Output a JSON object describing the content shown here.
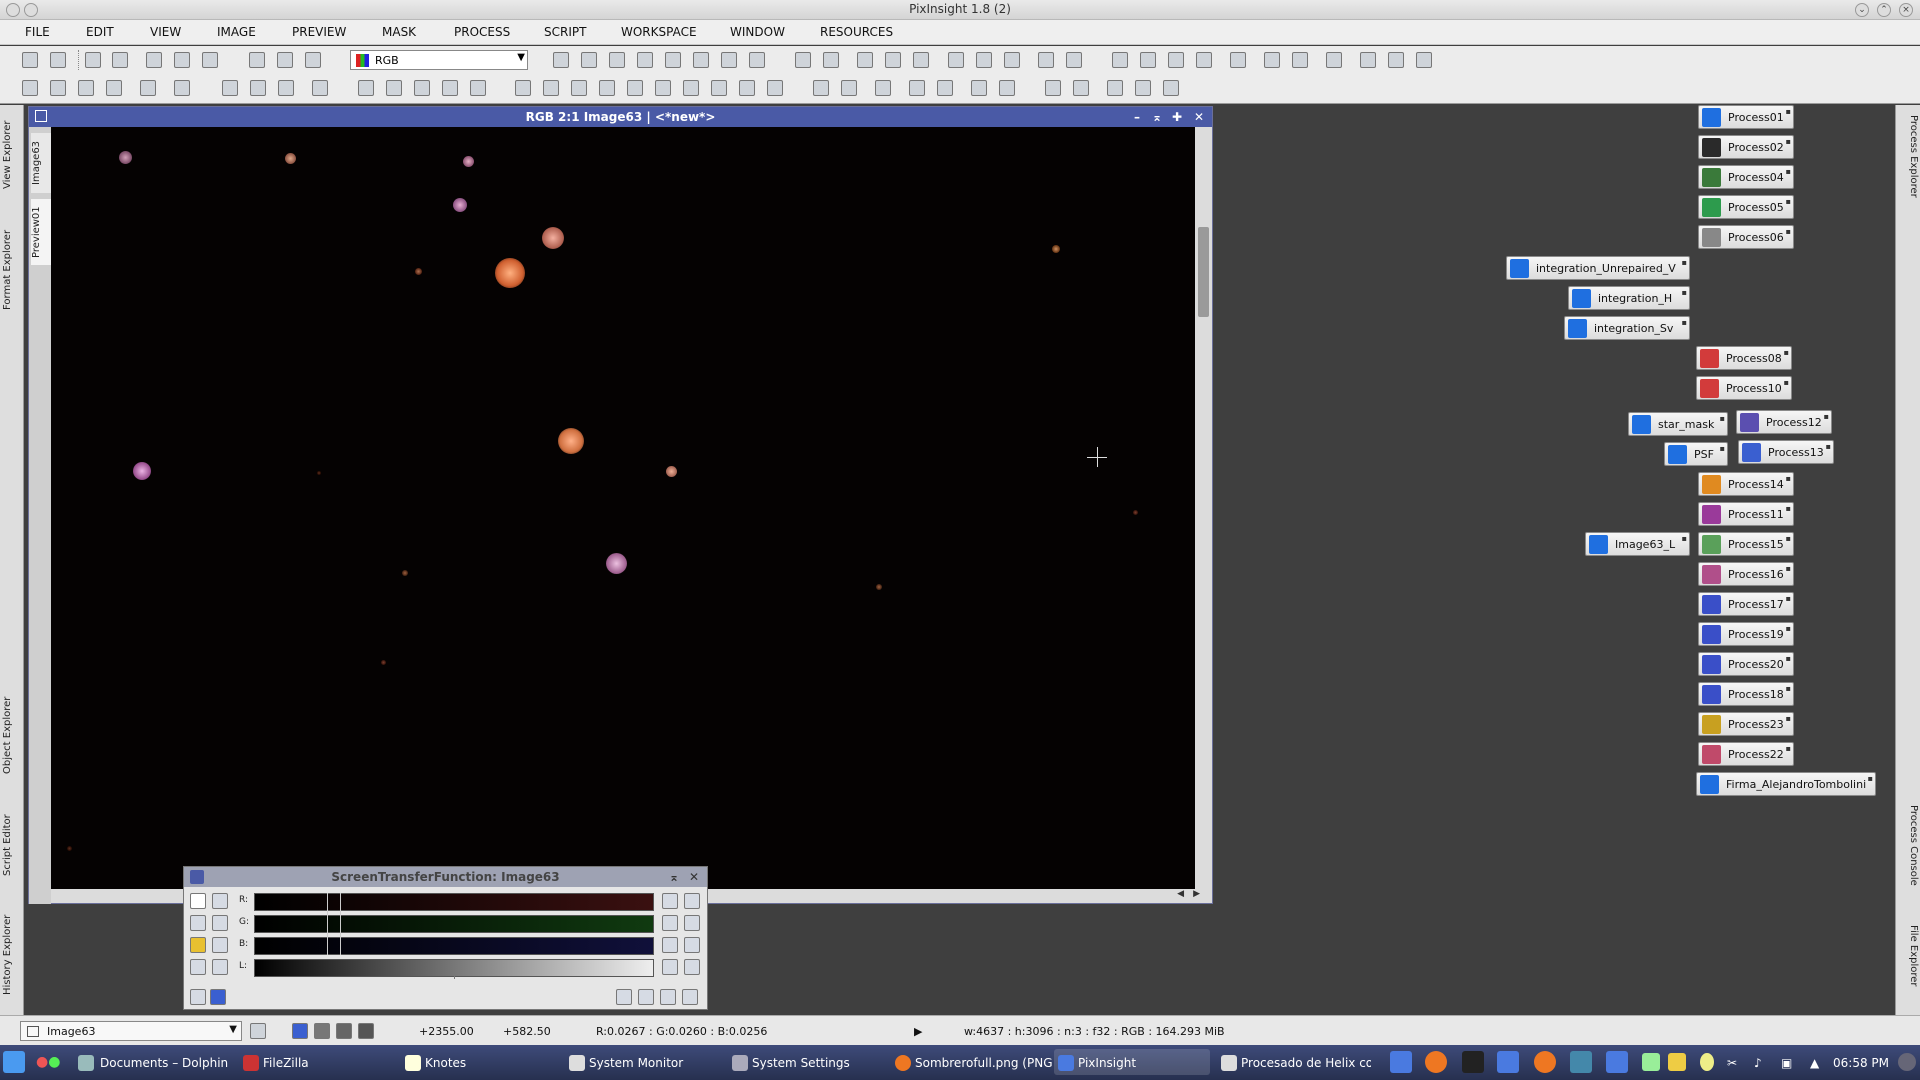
{
  "titlebar": {
    "title": "PixInsight 1.8 (2)"
  },
  "menu": [
    "FILE",
    "EDIT",
    "VIEW",
    "IMAGE",
    "PREVIEW",
    "MASK",
    "PROCESS",
    "SCRIPT",
    "WORKSPACE",
    "WINDOW",
    "RESOURCES"
  ],
  "toolbar": {
    "channel_select": "RGB"
  },
  "left_dock": {
    "tabs": [
      "View Explorer",
      "Format Explorer",
      "Object Explorer",
      "Script Editor",
      "History Explorer"
    ]
  },
  "right_dock": {
    "tabs": [
      "Process Explorer",
      "Process Console",
      "File Explorer"
    ]
  },
  "image_window": {
    "title": "RGB 2:1 Image63 | <*new*>",
    "side_tabs": [
      "Image63",
      "Preview01"
    ]
  },
  "stf": {
    "title": "ScreenTransferFunction: Image63",
    "channels": [
      "R:",
      "G:",
      "B:",
      "L:"
    ]
  },
  "status": {
    "view": "Image63",
    "x": "+2355.00",
    "y": "+582.50",
    "pixel": "R:0.0267 : G:0.0260 : B:0.0256",
    "info": "w:4637 : h:3096 : n:3 : f32 : RGB : 164.293 MiB"
  },
  "process_icons": [
    {
      "label": "Process01",
      "color": "#1f6fe0"
    },
    {
      "label": "Process02",
      "color": "#2a2a2a"
    },
    {
      "label": "Process04",
      "color": "#3a7a3a"
    },
    {
      "label": "Process05",
      "color": "#2d9b4d"
    },
    {
      "label": "Process06",
      "color": "#888888"
    },
    {
      "label": "integration_Unrepaired_V",
      "color": "#1f6fe0"
    },
    {
      "label": "integration_H",
      "color": "#1f6fe0"
    },
    {
      "label": "integration_Sv",
      "color": "#1f6fe0"
    },
    {
      "label": "Process08",
      "color": "#d23b3b"
    },
    {
      "label": "Process10",
      "color": "#d23b3b"
    },
    {
      "label": "star_mask",
      "color": "#1f6fe0"
    },
    {
      "label": "Process12",
      "color": "#5b4fb0"
    },
    {
      "label": "PSF",
      "color": "#1f6fe0"
    },
    {
      "label": "Process13",
      "color": "#3a5fd0"
    },
    {
      "label": "Process14",
      "color": "#e08a20"
    },
    {
      "label": "Process11",
      "color": "#9a3a9a"
    },
    {
      "label": "Image63_L",
      "color": "#1f6fe0"
    },
    {
      "label": "Process15",
      "color": "#5aa05a"
    },
    {
      "label": "Process16",
      "color": "#b04f8a"
    },
    {
      "label": "Process17",
      "color": "#3a4fc8"
    },
    {
      "label": "Process19",
      "color": "#3a4fc8"
    },
    {
      "label": "Process20",
      "color": "#3a4fc8"
    },
    {
      "label": "Process18",
      "color": "#3a4fc8"
    },
    {
      "label": "Process23",
      "color": "#c8a020"
    },
    {
      "label": "Process22",
      "color": "#c04a6a"
    },
    {
      "label": "Firma_AlejandroTombolini",
      "color": "#1f6fe0"
    }
  ],
  "taskbar": {
    "items": [
      "Documents – Dolphin",
      "FileZilla",
      "Knotes",
      "System Monitor",
      "System Settings",
      "Sombrerofull.png (PNG",
      "PixInsight",
      "Procesado de Helix con"
    ],
    "clock": "06:58 PM"
  }
}
